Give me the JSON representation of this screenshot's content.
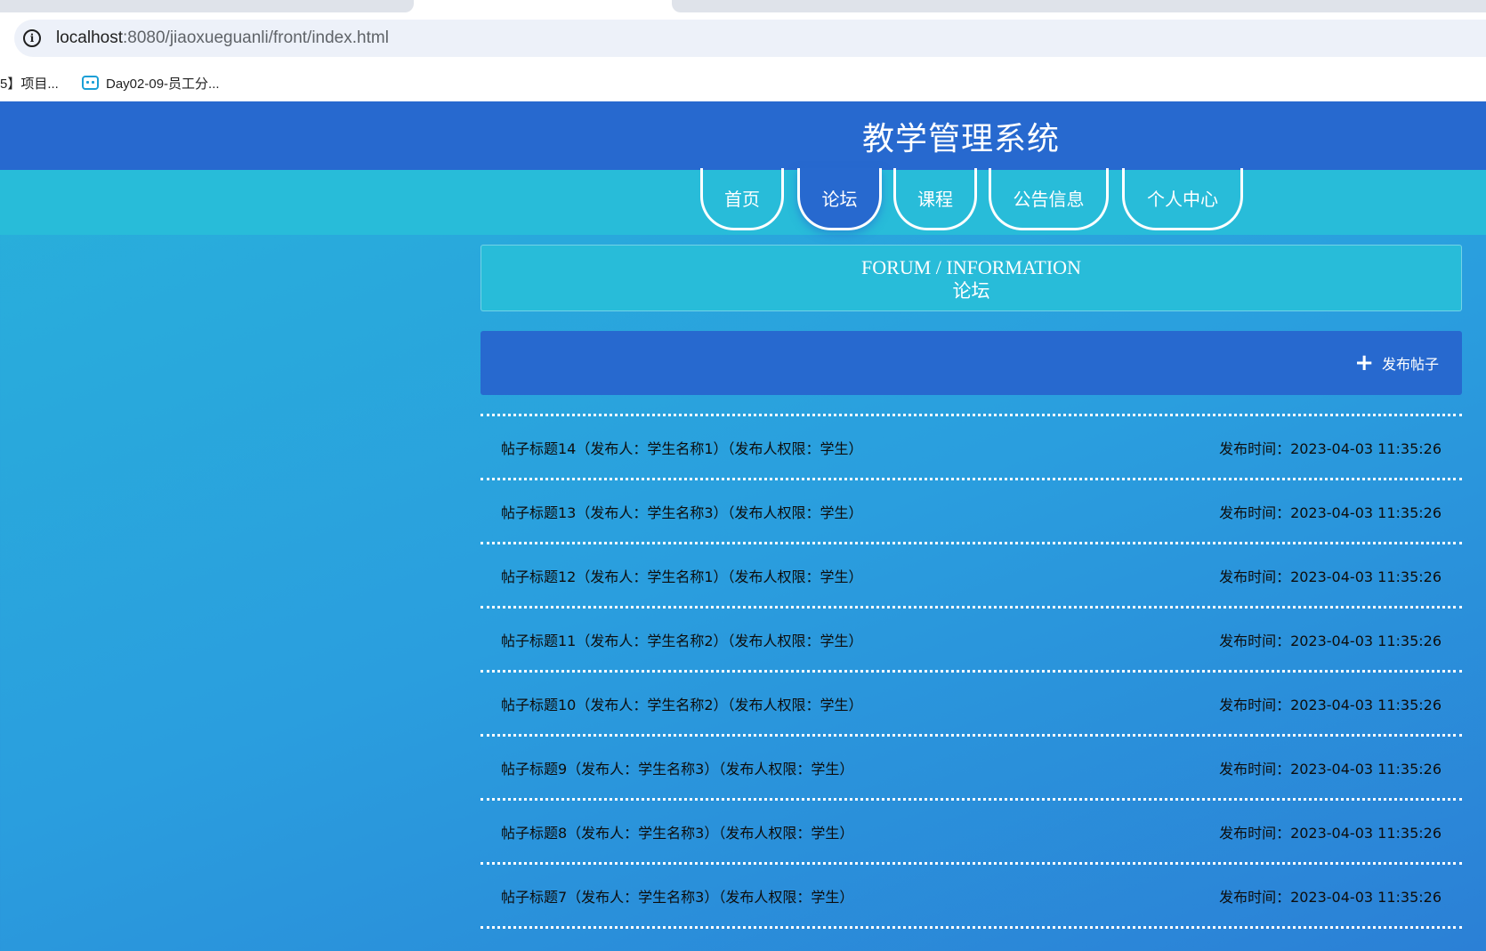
{
  "browser": {
    "url_host": "localhost",
    "url_rest": ":8080/jiaoxueguanli/front/index.html",
    "bookmarks": [
      {
        "label": "5】项目..."
      },
      {
        "label": "Day02-09-员工分..."
      }
    ]
  },
  "site": {
    "title": "教学管理系统",
    "nav": [
      {
        "label": "首页",
        "active": false
      },
      {
        "label": "论坛",
        "active": true
      },
      {
        "label": "课程",
        "active": false
      },
      {
        "label": "公告信息",
        "active": false
      },
      {
        "label": "个人中心",
        "active": false
      }
    ]
  },
  "forum": {
    "heading_en": "FORUM / INFORMATION",
    "heading_zh": "论坛",
    "publish_label": "发布帖子",
    "posts": [
      {
        "title": "帖子标题14（发布人：学生名称1）（发布人权限：学生）",
        "time": "发布时间：2023-04-03 11:35:26"
      },
      {
        "title": "帖子标题13（发布人：学生名称3）（发布人权限：学生）",
        "time": "发布时间：2023-04-03 11:35:26"
      },
      {
        "title": "帖子标题12（发布人：学生名称1）（发布人权限：学生）",
        "time": "发布时间：2023-04-03 11:35:26"
      },
      {
        "title": "帖子标题11（发布人：学生名称2）（发布人权限：学生）",
        "time": "发布时间：2023-04-03 11:35:26"
      },
      {
        "title": "帖子标题10（发布人：学生名称2）（发布人权限：学生）",
        "time": "发布时间：2023-04-03 11:35:26"
      },
      {
        "title": "帖子标题9（发布人：学生名称3）（发布人权限：学生）",
        "time": "发布时间：2023-04-03 11:35:26"
      },
      {
        "title": "帖子标题8（发布人：学生名称3）（发布人权限：学生）",
        "time": "发布时间：2023-04-03 11:35:26"
      },
      {
        "title": "帖子标题7（发布人：学生名称3）（发布人权限：学生）",
        "time": "发布时间：2023-04-03 11:35:26"
      }
    ]
  }
}
